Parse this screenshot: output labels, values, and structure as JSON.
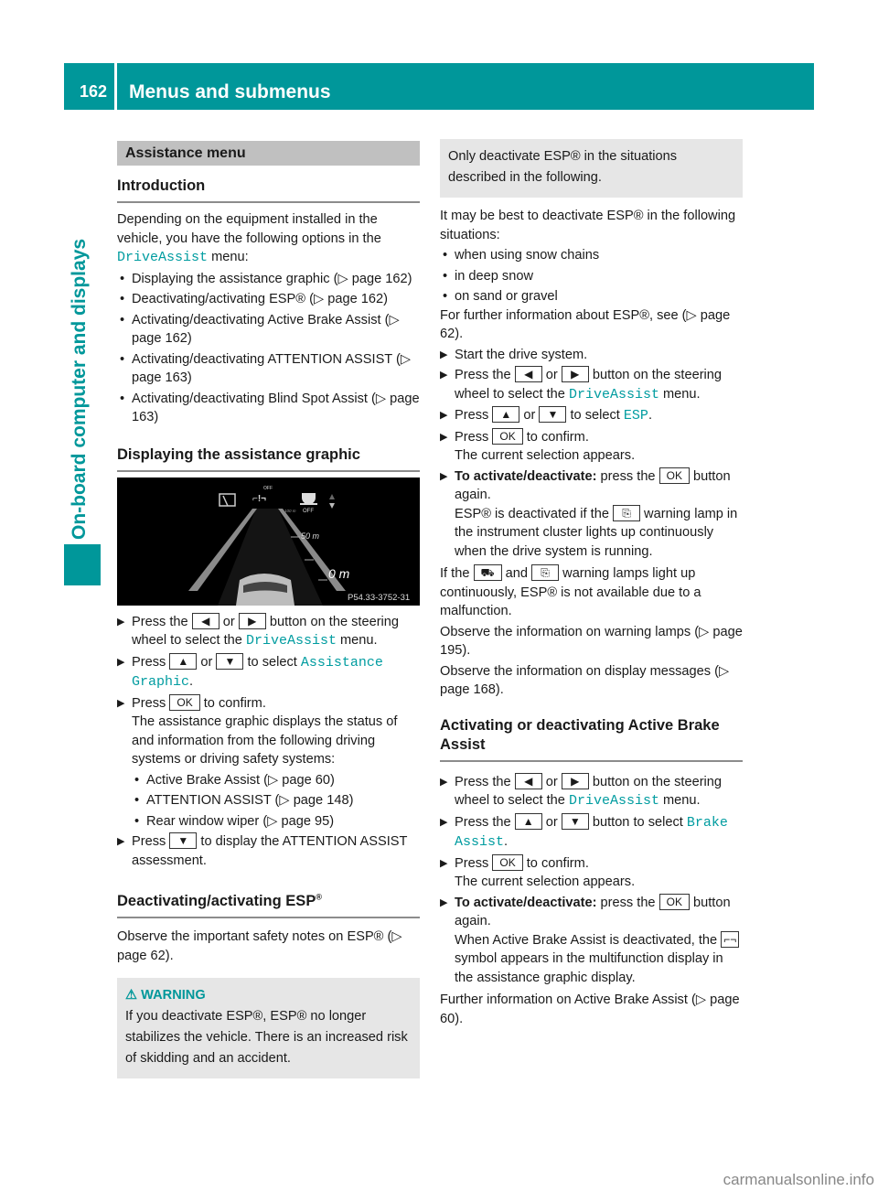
{
  "header": {
    "page_number": "162",
    "title": "Menus and submenus"
  },
  "sidebar": {
    "section": "On-board computer and displays"
  },
  "left": {
    "section_title": "Assistance menu",
    "intro_heading": "Introduction",
    "intro_text_1": "Depending on the equipment installed in the vehicle, you have the following options in the ",
    "intro_menu": "DriveAssist",
    "intro_text_2": " menu:",
    "intro_items": [
      "Displaying the assistance graphic (▷ page 162)",
      "Deactivating/activating ESP® (▷ page 162)",
      "Activating/deactivating Active Brake Assist (▷ page 162)",
      "Activating/deactivating ATTENTION ASSIST (▷ page 163)",
      "Activating/deactivating Blind Spot Assist (▷ page 163)"
    ],
    "graphic_heading": "Displaying the assistance graphic",
    "graphic": {
      "off_label": "OFF",
      "dist_100": "100 m",
      "dist_50": "50 m",
      "dist_0": "0 m",
      "cup_off": "OFF",
      "figure_id": "P54.33-3752-31"
    },
    "steps": {
      "s1_a": "Press the ",
      "or": " or ",
      "s1_b": " button on the steering wheel to select the ",
      "menu": "DriveAssist",
      "s1_c": " menu.",
      "s2_a": "Press ",
      "s2_b": " to select ",
      "s2_sel": "Assistance Graphic",
      "s2_c": ".",
      "s3_a": "Press ",
      "s3_b": " to confirm.",
      "s3_text": "The assistance graphic displays the status of and information from the following driving systems or driving safety systems:",
      "systems": [
        "Active Brake Assist (▷ page 60)",
        "ATTENTION ASSIST (▷ page 148)",
        "Rear window wiper (▷ page 95)"
      ],
      "s4_a": "Press ",
      "s4_b": " to display the ATTENTION ASSIST assessment."
    },
    "esp_heading": "Deactivating/activating ESP",
    "esp_text": "Observe the important safety notes on ESP® (▷ page 62).",
    "warning_title": "WARNING",
    "warning_text": "If you deactivate ESP®, ESP® no longer stabilizes the vehicle. There is an increased risk of skidding and an accident."
  },
  "keys": {
    "left": "◀",
    "right": "▶",
    "up": "▲",
    "down": "▼",
    "ok": "OK"
  },
  "right": {
    "note": "Only deactivate ESP® in the situations described in the following.",
    "intro": "It may be best to deactivate ESP® in the following situations:",
    "situations": [
      "when using snow chains",
      "in deep snow",
      "on sand or gravel"
    ],
    "further": "For further information about ESP®, see (▷ page 62).",
    "step1": "Start the drive system.",
    "s2_a": "Press the ",
    "or": " or ",
    "s2_b": " button on the steering wheel to select the ",
    "menu": "DriveAssist",
    "s2_c": " menu.",
    "s3_a": "Press ",
    "s3_b": " to select ",
    "s3_sel": "ESP",
    "s3_c": ".",
    "s4_a": "Press ",
    "s4_b": " to confirm.",
    "s4_text": "The current selection appears.",
    "s5_bold": "To activate/deactivate:",
    "s5_a": " press the ",
    "s5_b": " button again.",
    "s5_text_a": "ESP® is deactivated if the ",
    "s5_text_b": " warning lamp in the instrument cluster lights up continuously when the drive system is running.",
    "malf_a": "If the ",
    "malf_and": " and ",
    "malf_b": " warning lamps light up continuously, ESP® is not available due to a malfunction.",
    "lamps_info": "Observe the information on warning lamps (▷ page 195).",
    "display_info": "Observe the information on display messages (▷ page 168).",
    "abs_heading": "Activating or deactivating Active Brake Assist",
    "b1_a": "Press the ",
    "b1_b": " button on the steering wheel to select the ",
    "b1_menu": "DriveAssist",
    "b1_c": " menu.",
    "b2_a": "Press the ",
    "b2_b": " button to select ",
    "b2_sel": "Brake Assist",
    "b2_c": ".",
    "b3_a": "Press ",
    "b3_b": " to confirm.",
    "b3_text": "The current selection appears.",
    "b4_bold": "To activate/deactivate:",
    "b4_a": " press the ",
    "b4_b": " button again.",
    "b4_text_a": "When Active Brake Assist is deactivated, the ",
    "b4_text_b": " symbol appears in the multifunction display in the assistance graphic display.",
    "abs_further": "Further information on Active Brake Assist (▷ page 60)."
  },
  "watermark": "carmanualsonline.info"
}
